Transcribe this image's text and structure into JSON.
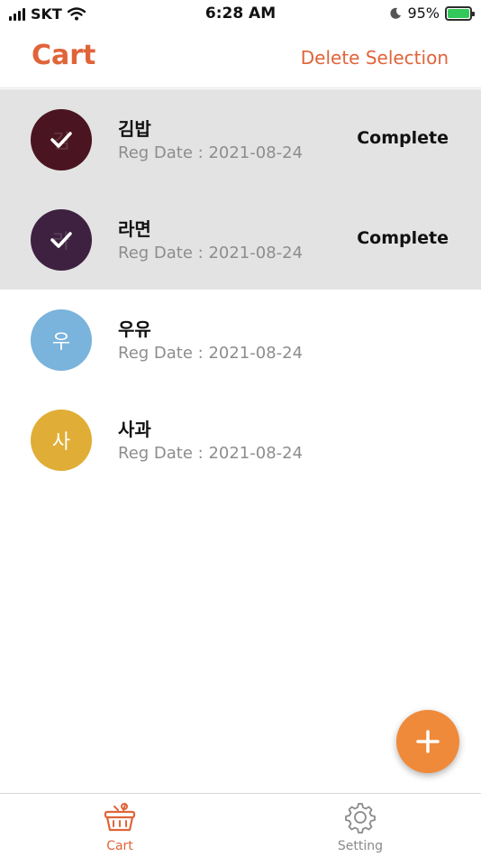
{
  "status_bar": {
    "carrier": "SKT",
    "time": "6:28 AM",
    "battery": "95%"
  },
  "header": {
    "title": "Cart",
    "action": "Delete Selection"
  },
  "items": [
    {
      "initial": "김",
      "name": "김밥",
      "reg": "Reg Date : 2021-08-24",
      "status": "Complete",
      "selected": true,
      "color": "#4a1520"
    },
    {
      "initial": "라",
      "name": "라면",
      "reg": "Reg Date : 2021-08-24",
      "status": "Complete",
      "selected": true,
      "color": "#3e2140"
    },
    {
      "initial": "우",
      "name": "우유",
      "reg": "Reg Date : 2021-08-24",
      "status": "",
      "selected": false,
      "color": "#7ab3dc"
    },
    {
      "initial": "사",
      "name": "사과",
      "reg": "Reg Date : 2021-08-24",
      "status": "",
      "selected": false,
      "color": "#e0ad36"
    }
  ],
  "fab": {
    "icon": "plus-icon"
  },
  "tabs": [
    {
      "label": "Cart",
      "icon": "basket-icon",
      "active": true
    },
    {
      "label": "Setting",
      "icon": "gear-icon",
      "active": false
    }
  ],
  "colors": {
    "accent": "#e0643a",
    "fab": "#ef8a3a",
    "selected_row": "#e3e3e3"
  }
}
